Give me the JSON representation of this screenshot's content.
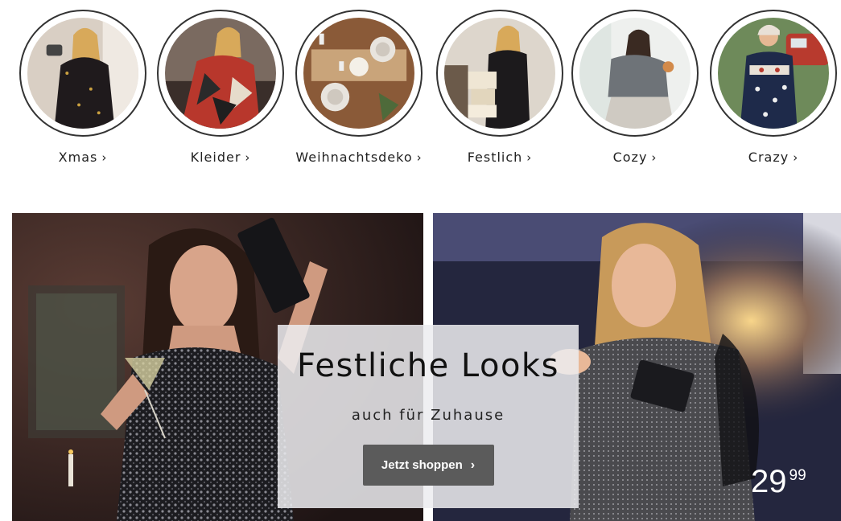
{
  "categories": [
    {
      "label": "Xmas",
      "chevron": "›"
    },
    {
      "label": "Kleider",
      "chevron": "›"
    },
    {
      "label": "Weihnachtsdeko",
      "chevron": "›"
    },
    {
      "label": "Festlich",
      "chevron": "›"
    },
    {
      "label": "Cozy",
      "chevron": "›"
    },
    {
      "label": "Crazy",
      "chevron": "›"
    }
  ],
  "banner": {
    "title": "Festliche Looks",
    "subtitle": "auch für Zuhause",
    "cta_label": "Jetzt shoppen",
    "cta_chevron": "›",
    "price_int": "29",
    "price_dec": "99"
  },
  "colors": {
    "ring": "#333333",
    "cta_bg": "#5b5b5b",
    "overlay_bg": "#ececf0"
  }
}
